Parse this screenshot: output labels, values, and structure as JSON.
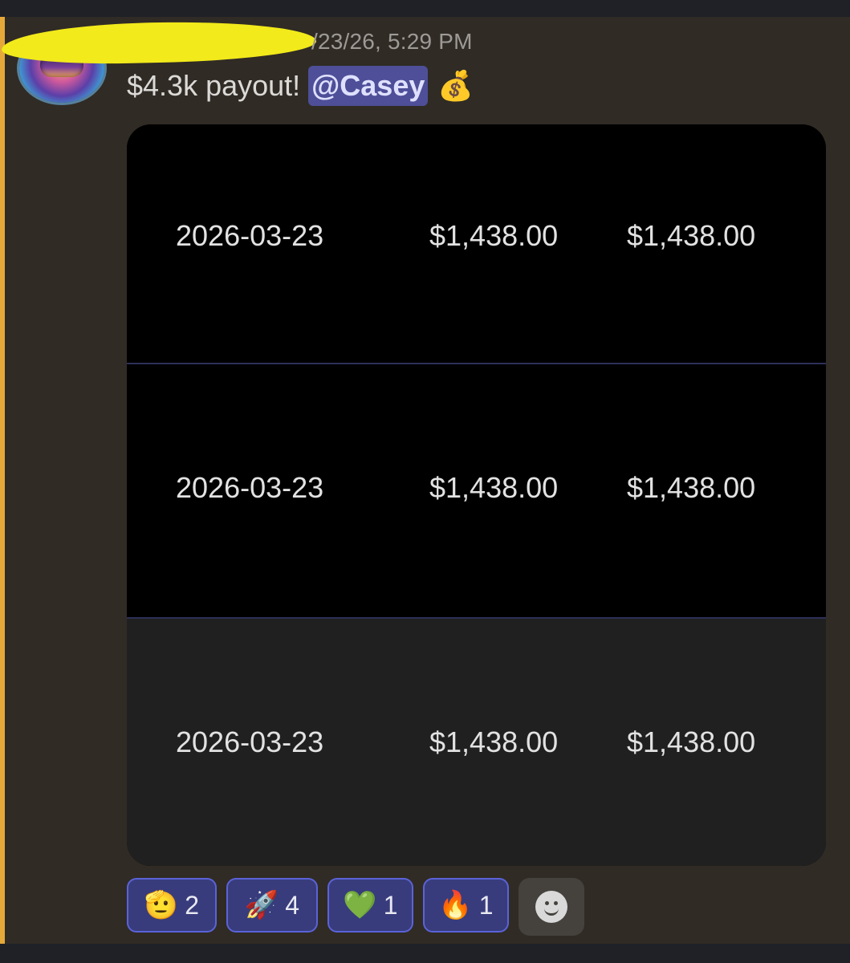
{
  "message": {
    "timestamp": "/23/26, 5:29 PM",
    "text": "$4.3k payout!",
    "mention": "@Casey",
    "emoji": "💰"
  },
  "payout_table": {
    "rows": [
      {
        "date": "2026-03-23",
        "amount_1": "$1,438.00",
        "amount_2": "$1,438.00"
      },
      {
        "date": "2026-03-23",
        "amount_1": "$1,438.00",
        "amount_2": "$1,438.00"
      },
      {
        "date": "2026-03-23",
        "amount_1": "$1,438.00",
        "amount_2": "$1,438.00"
      }
    ]
  },
  "reactions": [
    {
      "emoji": "🫡",
      "count": "2",
      "icon": "salute-face-icon"
    },
    {
      "emoji": "🚀",
      "count": "4",
      "icon": "rocket-icon"
    },
    {
      "emoji": "💚",
      "count": "1",
      "icon": "green-heart-icon"
    },
    {
      "emoji": "🔥",
      "count": "1",
      "icon": "fire-icon"
    }
  ],
  "add_reaction": {
    "icon": "add-reaction-smiley-icon"
  },
  "colors": {
    "background": "#302b25",
    "highlight_bar": "#e5a93a",
    "mention_bg": "#4e4f98",
    "reaction_bg": "#383c7c",
    "reaction_border": "#5b63d8",
    "table_divider": "#2d2f58"
  }
}
